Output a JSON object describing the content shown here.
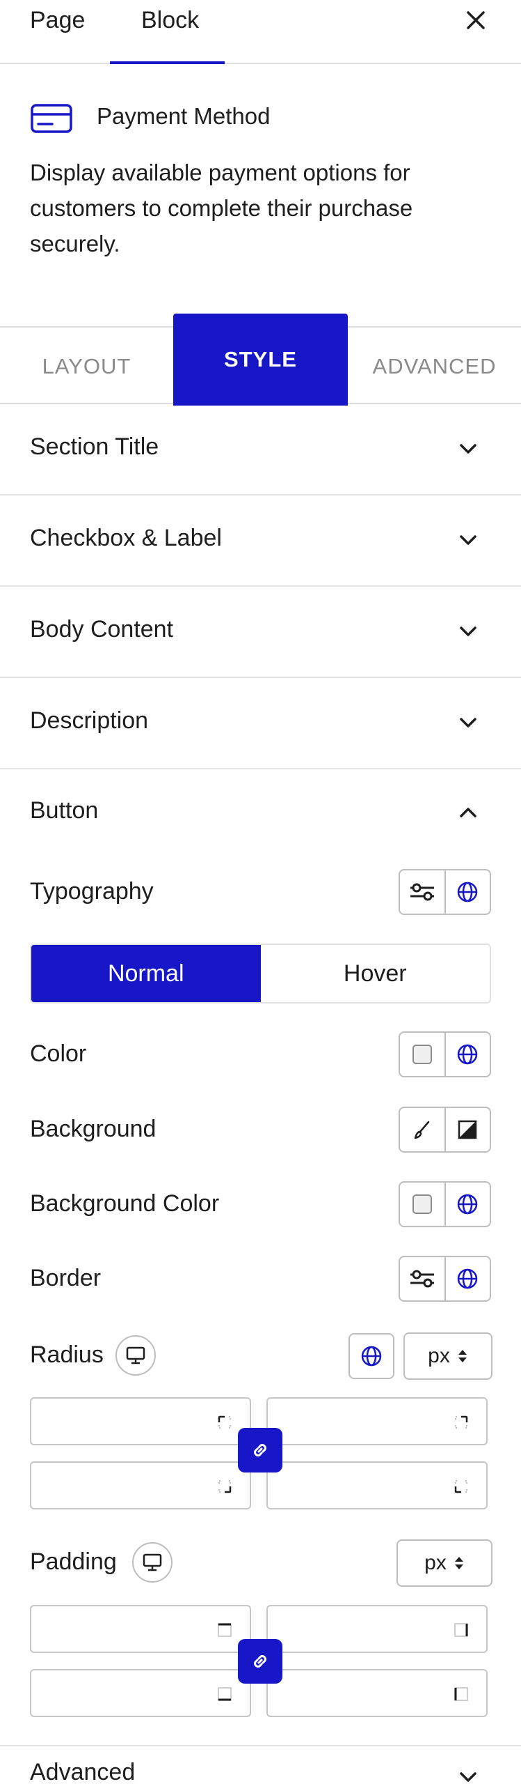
{
  "tabs": {
    "page": "Page",
    "block": "Block"
  },
  "block": {
    "icon": "credit-card-icon",
    "title": "Payment Method",
    "description": "Display available payment options for customers to complete their purchase securely."
  },
  "style_tabs": {
    "layout": "LAYOUT",
    "style": "STYLE",
    "advanced": "ADVANCED",
    "active": "STYLE"
  },
  "sections": {
    "section_title": "Section Title",
    "checkbox_label": "Checkbox & Label",
    "body_content": "Body Content",
    "description": "Description",
    "button": "Button",
    "advanced": "Advanced"
  },
  "button_panel": {
    "typography": "Typography",
    "state_normal": "Normal",
    "state_hover": "Hover",
    "active_state": "Normal",
    "color": "Color",
    "background": "Background",
    "background_color": "Background Color",
    "border": "Border",
    "radius": "Radius",
    "radius_unit": "px",
    "padding": "Padding",
    "padding_unit": "px"
  },
  "colors": {
    "accent": "#1717c8",
    "border": "#bdbdbd",
    "divider": "#e2e2e2"
  }
}
